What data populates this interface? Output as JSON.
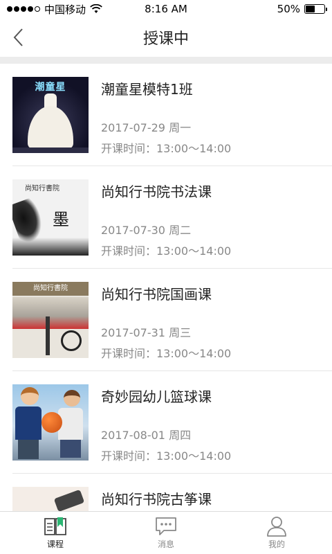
{
  "status_bar": {
    "carrier": "中国移动",
    "time": "8:16 AM",
    "battery_percent": "50%",
    "battery_level": 0.5
  },
  "nav": {
    "title": "授课中"
  },
  "courses": [
    {
      "title": "潮童星模特1班",
      "date": "2017-07-29 周一",
      "time": "开课时间：13:00～14:00",
      "thumb_text": "潮童星"
    },
    {
      "title": "尚知行书院书法课",
      "date": "2017-07-30 周二",
      "time": "开课时间：13:00～14:00",
      "thumb_text": "尚知行書院"
    },
    {
      "title": "尚知行书院国画课",
      "date": "2017-07-31 周三",
      "time": "开课时间：13:00～14:00",
      "thumb_text": "尚知行書院"
    },
    {
      "title": "奇妙园幼儿篮球课",
      "date": "2017-08-01 周四",
      "time": "开课时间：13:00～14:00"
    },
    {
      "title": "尚知行书院古筝课",
      "date": "",
      "time": ""
    }
  ],
  "tabs": [
    {
      "label": "课程",
      "icon": "book-icon",
      "active": true
    },
    {
      "label": "消息",
      "icon": "chat-icon",
      "active": false
    },
    {
      "label": "我的",
      "icon": "user-icon",
      "active": false
    }
  ],
  "colors": {
    "accent": "#2bb673",
    "separator": "#ececec",
    "secondary_text": "#888888"
  }
}
